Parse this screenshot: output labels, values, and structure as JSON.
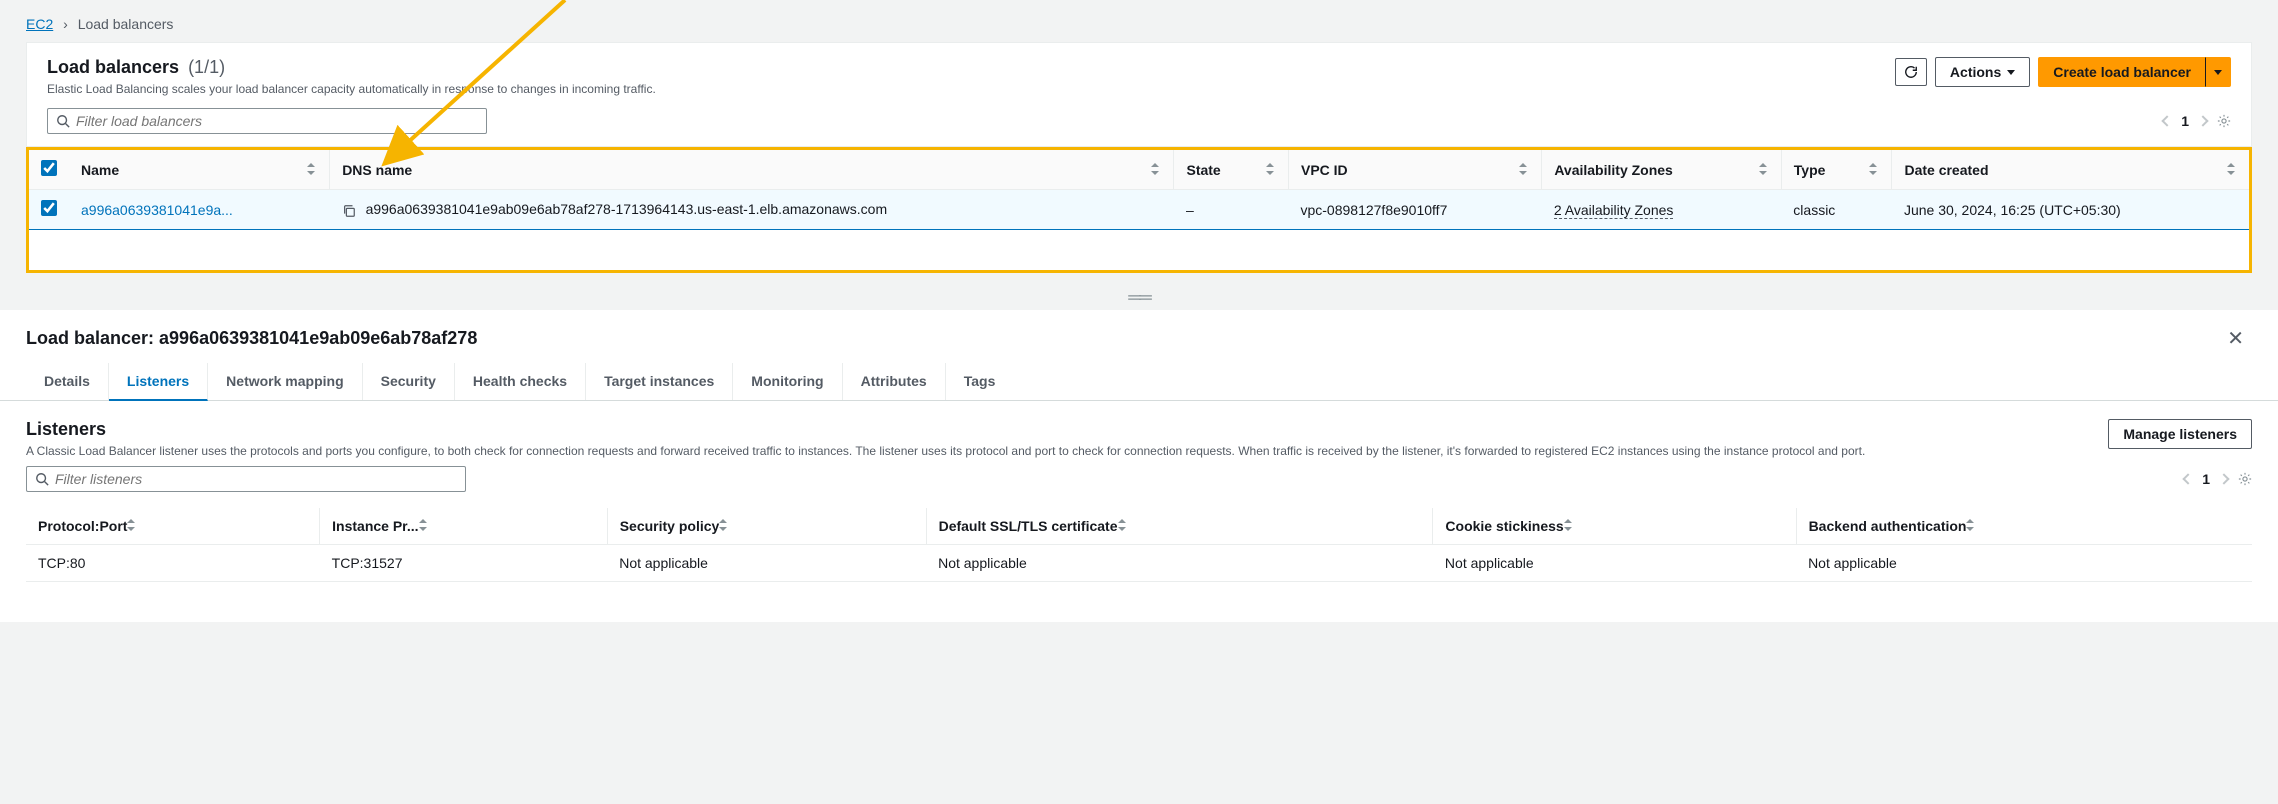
{
  "breadcrumb": {
    "root": "EC2",
    "current": "Load balancers"
  },
  "header": {
    "title": "Load balancers",
    "count": "(1/1)",
    "subtitle": "Elastic Load Balancing scales your load balancer capacity automatically in response to changes in incoming traffic.",
    "refresh_tooltip": "Refresh",
    "actions_label": "Actions",
    "create_label": "Create load balancer"
  },
  "filter": {
    "placeholder": "Filter load balancers"
  },
  "pager": {
    "page": "1"
  },
  "columns": {
    "name": "Name",
    "dns": "DNS name",
    "state": "State",
    "vpc": "VPC ID",
    "az": "Availability Zones",
    "type": "Type",
    "created": "Date created"
  },
  "rows": [
    {
      "name": "a996a0639381041e9a...",
      "dns": "a996a0639381041e9ab09e6ab78af278-1713964143.us-east-1.elb.amazonaws.com",
      "state": "–",
      "vpc": "vpc-0898127f8e9010ff7",
      "az": "2 Availability Zones",
      "type": "classic",
      "created": "June 30, 2024, 16:25 (UTC+05:30)"
    }
  ],
  "detail": {
    "prefix": "Load balancer: ",
    "name": "a996a0639381041e9ab09e6ab78af278",
    "tabs": [
      "Details",
      "Listeners",
      "Network mapping",
      "Security",
      "Health checks",
      "Target instances",
      "Monitoring",
      "Attributes",
      "Tags"
    ],
    "active_tab": "Listeners",
    "listeners": {
      "title": "Listeners",
      "desc": "A Classic Load Balancer listener uses the protocols and ports you configure, to both check for connection requests and forward received traffic to instances. The listener uses its protocol and port to check for connection requests. When traffic is received by the listener, it's forwarded to registered EC2 instances using the instance protocol and port.",
      "manage_label": "Manage listeners",
      "filter_placeholder": "Filter listeners",
      "page": "1",
      "cols": {
        "protoport": "Protocol:Port",
        "instance": "Instance Pr...",
        "secpol": "Security policy",
        "sslcert": "Default SSL/TLS certificate",
        "cookie": "Cookie stickiness",
        "backend": "Backend authentication"
      },
      "rows": [
        {
          "protoport": "TCP:80",
          "instance": "TCP:31527",
          "secpol": "Not applicable",
          "sslcert": "Not applicable",
          "cookie": "Not applicable",
          "backend": "Not applicable"
        }
      ]
    }
  }
}
